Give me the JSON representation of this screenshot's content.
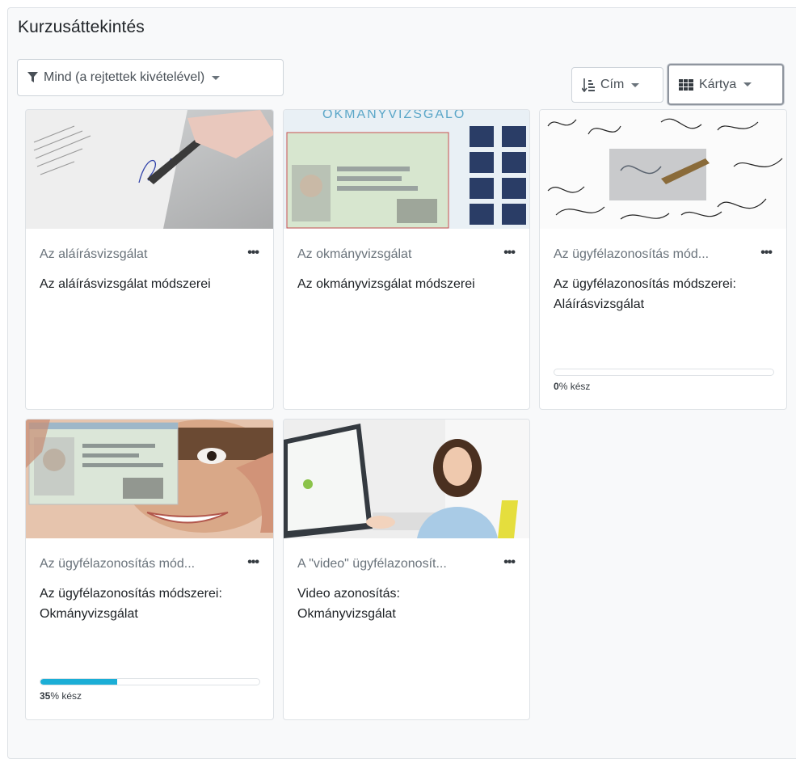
{
  "block": {
    "title": "Kurzusáttekintés",
    "filter_label": "Mind (a rejtettek kivételével)",
    "sort_label": "Cím",
    "view_label": "Kártya"
  },
  "courses": [
    {
      "category": "Az aláírásvizsgálat",
      "name": "Az aláírásvizsgálat módszerei",
      "image": "signing-document-photo"
    },
    {
      "category": "Az okmányvizsgálat",
      "name": "Az okmányvizsgálat módszerei",
      "image": "id-card-analysis-photo",
      "image_heading": "OKMANYVIZSGALO"
    },
    {
      "category": "Az ügyfélazonosítás mód...",
      "name": "Az ügyfélazonosítás módszerei: Aláírásvizsgálat",
      "image": "signatures-pattern-photo",
      "progress_value": "0",
      "progress_suffix": "% kész",
      "progress_fraction": 0.0
    },
    {
      "category": "Az ügyfélazonosítás mód...",
      "name": "Az ügyfélazonosítás módszerei: Okmányvizsgálat",
      "image": "woman-with-id-card-photo",
      "progress_value": "35",
      "progress_suffix": "% kész",
      "progress_fraction": 0.35
    },
    {
      "category": "A \"video\" ügyfélazonosít...",
      "name": "Video azonosítás: Okmányvizsgálat",
      "image": "video-identification-photo"
    }
  ],
  "icons": {
    "filter": "filter-icon",
    "sort": "sort-amount-icon",
    "view": "grid-icon",
    "more": "ellipsis-icon"
  },
  "colors": {
    "progress": "#1baed6",
    "panel_bg": "#f8f9fa"
  }
}
